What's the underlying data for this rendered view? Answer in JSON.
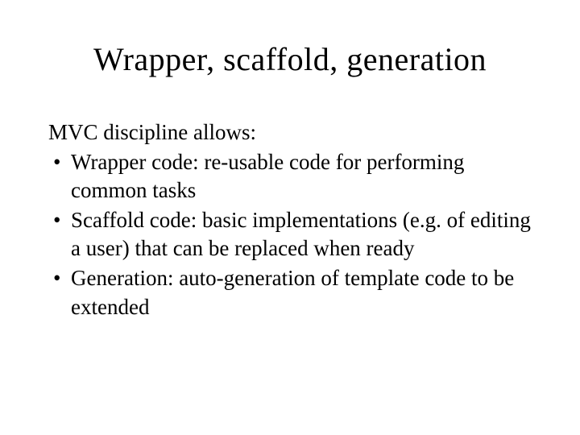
{
  "slide": {
    "title": "Wrapper, scaffold, generation",
    "intro": "MVC discipline allows:",
    "bullets": [
      "Wrapper code: re-usable code for performing common tasks",
      "Scaffold code: basic implementations (e.g. of editing a user) that can be replaced when ready",
      "Generation: auto-generation of template code to be extended"
    ]
  }
}
